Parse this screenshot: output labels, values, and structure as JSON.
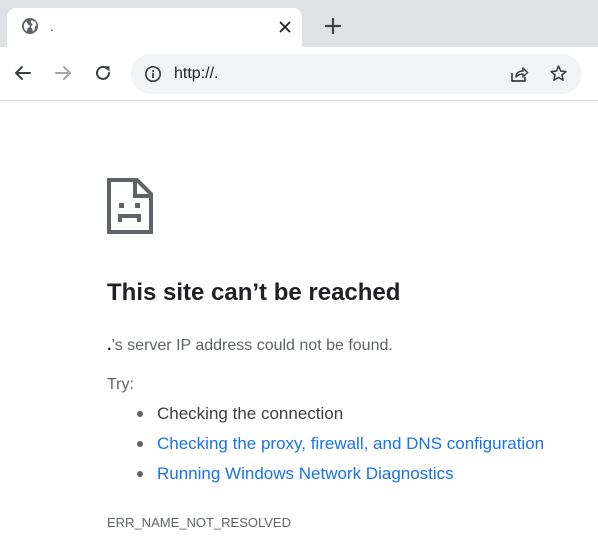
{
  "tab": {
    "title": ".",
    "favicon": "globe-icon",
    "close_icon": "close-icon"
  },
  "new_tab_icon": "plus-icon",
  "toolbar": {
    "back_icon": "arrow-left-icon",
    "forward_icon": "arrow-right-icon",
    "reload_icon": "reload-icon"
  },
  "omnibox": {
    "info_icon": "info-icon",
    "url": "http://.",
    "share_icon": "share-icon",
    "bookmark_icon": "star-icon"
  },
  "error_page": {
    "icon": "sad-page-icon",
    "heading": "This site can’t be reached",
    "host": ".",
    "message": "’s server IP address could not be found.",
    "try_label": "Try:",
    "suggestions": [
      {
        "text": "Checking the connection",
        "link": false
      },
      {
        "text": "Checking the proxy, firewall, and DNS configuration",
        "link": true
      },
      {
        "text": "Running Windows Network Diagnostics",
        "link": true
      }
    ],
    "error_code": "ERR_NAME_NOT_RESOLVED"
  },
  "colors": {
    "link": "#1a73e8",
    "tabstrip": "#dee1e6",
    "omnibox": "#f1f3f4",
    "text_secondary": "#5f6368",
    "text_primary": "#202124"
  }
}
